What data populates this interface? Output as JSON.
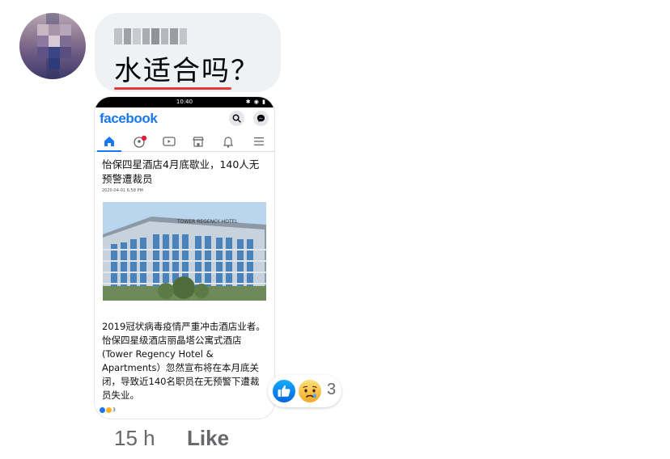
{
  "comment": {
    "author_name_hidden": true,
    "text": "水适合吗？"
  },
  "screenshot": {
    "status_time": "10:40",
    "status_icons": "✱ ◉ ▮",
    "app_logo": "facebook",
    "article": {
      "title": "怡保四星酒店4月底歇业，140人无预警遭裁员",
      "date": "2020-04-01 6:58 PM",
      "photo_sign": "TOWER REGENCY HOTEL",
      "body": "2019冠状病毒疫情严重冲击酒店业者。怡保四星级酒店丽晶塔公寓式酒店(Tower Regency Hotel & Apartments）忽然宣布将在本月底关闭，导致近140名职员在无预警下遭裁员失业。"
    },
    "mini_reaction_count": "3"
  },
  "reactions": {
    "icons": [
      "like-icon",
      "sad-icon"
    ],
    "count": "3"
  },
  "meta": {
    "time": "15 h",
    "like_label": "Like"
  },
  "colors": {
    "bubble": "#eff2f5",
    "facebook_blue": "#1877f2",
    "meta_gray": "#65676b",
    "spell_underline": "#e53935"
  }
}
